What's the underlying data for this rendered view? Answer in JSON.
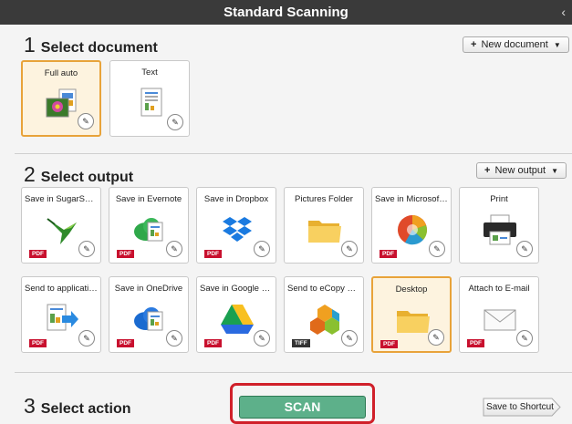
{
  "window": {
    "title": "Standard Scanning",
    "collapse_glyph": "‹"
  },
  "sections": {
    "document": {
      "number": "1",
      "label": "Select document",
      "new_button": "New document"
    },
    "output": {
      "number": "2",
      "label": "Select output",
      "new_button": "New output"
    },
    "action": {
      "number": "3",
      "label": "Select action"
    }
  },
  "documents": [
    {
      "label": "Full auto",
      "icon": "full-auto-photo-icon",
      "selected": true
    },
    {
      "label": "Text",
      "icon": "text-document-icon",
      "selected": false
    }
  ],
  "outputs": [
    {
      "label": "Save in SugarSync",
      "icon": "sugarsync-hummingbird-icon",
      "tag": "PDF",
      "selected": false
    },
    {
      "label": "Save in Evernote",
      "icon": "evernote-cloud-icon",
      "tag": "PDF",
      "selected": false
    },
    {
      "label": "Save in Dropbox",
      "icon": "dropbox-icon",
      "tag": "PDF",
      "selected": false
    },
    {
      "label": "Pictures Folder",
      "icon": "folder-icon",
      "tag": "",
      "selected": false
    },
    {
      "label": "Save in Microsoft S...",
      "icon": "microsoft-sharepoint-icon",
      "tag": "PDF",
      "selected": false
    },
    {
      "label": "Print",
      "icon": "printer-icon",
      "tag": "",
      "selected": false
    },
    {
      "label": "Send to application",
      "icon": "send-to-app-icon",
      "tag": "PDF",
      "selected": false
    },
    {
      "label": "Save in OneDrive",
      "icon": "onedrive-cloud-icon",
      "tag": "PDF",
      "selected": false
    },
    {
      "label": "Save in Google Dri...",
      "icon": "google-drive-icon",
      "tag": "PDF",
      "selected": false
    },
    {
      "label": "Send to eCopy PD...",
      "icon": "ecopy-icon",
      "tag": "TIFF",
      "selected": false
    },
    {
      "label": "Desktop",
      "icon": "desktop-folder-icon",
      "tag": "PDF",
      "selected": true
    },
    {
      "label": "Attach to E-mail",
      "icon": "email-envelope-icon",
      "tag": "PDF",
      "selected": false
    }
  ],
  "actions": {
    "scan_label": "SCAN",
    "shortcut_label": "Save to Shortcut"
  },
  "colors": {
    "accent_selected": "#e8a33a",
    "scan_green": "#5db08a",
    "highlight_red": "#d0202a",
    "pdf_red": "#c8102e"
  }
}
